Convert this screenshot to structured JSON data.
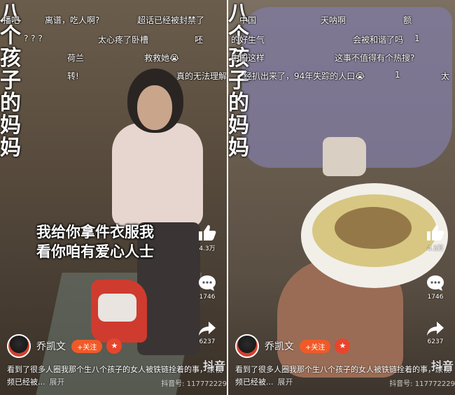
{
  "left": {
    "vertical_title": [
      "八",
      "个",
      "孩",
      "子",
      "的",
      "妈",
      "妈"
    ],
    "danmaku": [
      {
        "text": "播吧",
        "row": 0
      },
      {
        "text": "离谱，吃人啊?",
        "row": 0
      },
      {
        "text": "超话已经被封禁了",
        "row": 0
      },
      {
        "text": "? ? ?",
        "row": 1
      },
      {
        "text": "太心疼了卧槽",
        "row": 1
      },
      {
        "text": "呸",
        "row": 1
      },
      {
        "text": "荷兰",
        "row": 2
      },
      {
        "text": "救救她😭",
        "row": 2
      },
      {
        "text": "转!",
        "row": 3
      },
      {
        "text": "真的无法理解",
        "row": 3
      }
    ],
    "subtitle_line1": "我给你拿件衣服我",
    "subtitle_line2": "看你咱有爱心人士",
    "like_count": "4.3万",
    "comment_count": "1746",
    "share_count": "6237",
    "author_name": "乔凯文",
    "follow_label": "+关注",
    "description": "看到了很多人圈我那个生八个孩子的女人被铁链拴着的事，原视频已经被...",
    "more_label": "展开",
    "brand": "抖音",
    "douyin_id": "抖音号: 117772229"
  },
  "right": {
    "vertical_title": [
      "八",
      "个",
      "孩",
      "子",
      "的",
      "妈",
      "妈"
    ],
    "danmaku": [
      {
        "text": "中国",
        "row": 0
      },
      {
        "text": "天呐啊",
        "row": 0
      },
      {
        "text": "额",
        "row": 0
      },
      {
        "text": "的好生气",
        "row": 1
      },
      {
        "text": "会被和谐了吗",
        "row": 1
      },
      {
        "text": "1",
        "row": 1
      },
      {
        "text": "中国这样",
        "row": 2
      },
      {
        "text": "这事不值得有个热搜?",
        "row": 2
      },
      {
        "text": "经扒出来了，94年失踪的人口😭",
        "row": 3
      },
      {
        "text": "1",
        "row": 3
      },
      {
        "text": "太",
        "row": 3
      }
    ],
    "like_count": "4.3万",
    "comment_count": "1746",
    "share_count": "6237",
    "author_name": "乔凯文",
    "follow_label": "+关注",
    "description": "看到了很多人圈我那个生八个孩子的女人被铁链拴着的事，原视频已经被...",
    "more_label": "展开",
    "brand": "抖音",
    "douyin_id": "抖音号: 117772229"
  },
  "colors": {
    "follow": "#f05a28",
    "white": "#ffffff"
  }
}
